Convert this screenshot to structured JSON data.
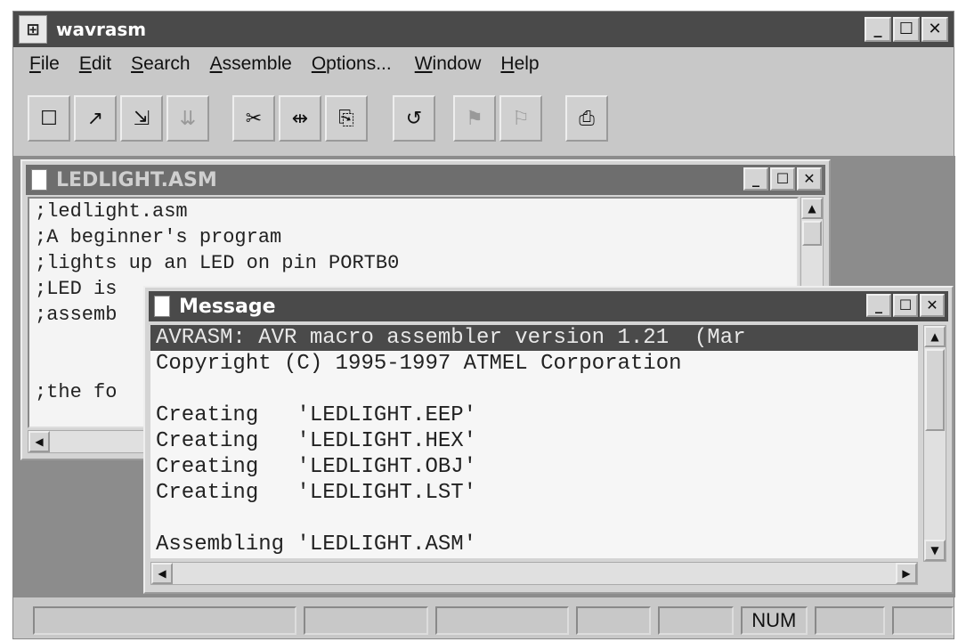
{
  "app": {
    "title": "wavrasm",
    "icon": "app-icon"
  },
  "window_buttons": {
    "minimize": "_",
    "maximize": "☐",
    "close": "✕"
  },
  "menu": [
    {
      "mnemonic": "F",
      "rest": "ile"
    },
    {
      "mnemonic": "E",
      "rest": "dit"
    },
    {
      "mnemonic": "S",
      "rest": "earch"
    },
    {
      "mnemonic": "A",
      "rest": "ssemble"
    },
    {
      "mnemonic": "O",
      "rest": "ptions..."
    },
    {
      "mnemonic": "W",
      "rest": "indow"
    },
    {
      "mnemonic": "H",
      "rest": "elp"
    }
  ],
  "toolbar": {
    "icons": [
      "new-file-icon",
      "open-file-icon",
      "save-file-icon",
      "save-all-icon",
      "cut-icon",
      "copy-icon",
      "paste-icon",
      "undo-icon",
      "assemble-icon",
      "build-icon",
      "print-icon"
    ],
    "glyphs": [
      "☐",
      "↗",
      "⇲",
      "⇊",
      "✂",
      "⇹",
      "⎘",
      "↺",
      "⚑",
      "⚐",
      "⎙"
    ]
  },
  "editor": {
    "title": "LEDLIGHT.ASM",
    "lines": [
      ";ledlight.asm",
      ";A beginner's program",
      ";lights up an LED on pin PORTB0",
      ";LED is",
      ";assemb",
      "",
      "",
      ";the fo"
    ]
  },
  "message": {
    "title": "Message",
    "lines": [
      "AVRASM: AVR macro assembler version 1.21  (Mar",
      "Copyright (C) 1995-1997 ATMEL Corporation",
      "",
      "Creating   'LEDLIGHT.EEP'",
      "Creating   'LEDLIGHT.HEX'",
      "Creating   'LEDLIGHT.OBJ'",
      "Creating   'LEDLIGHT.LST'",
      "",
      "Assembling 'LEDLIGHT.ASM'"
    ]
  },
  "scroll": {
    "up": "▲",
    "down": "▼",
    "left": "◀",
    "right": "▶"
  },
  "statusbar": {
    "panels": [
      "",
      "",
      "",
      "",
      "",
      "NUM",
      "",
      ""
    ]
  },
  "colors": {
    "titlebar": "#4a4a4a",
    "highlight": "#4a4a4a",
    "desktop": "#8c8c8c"
  }
}
